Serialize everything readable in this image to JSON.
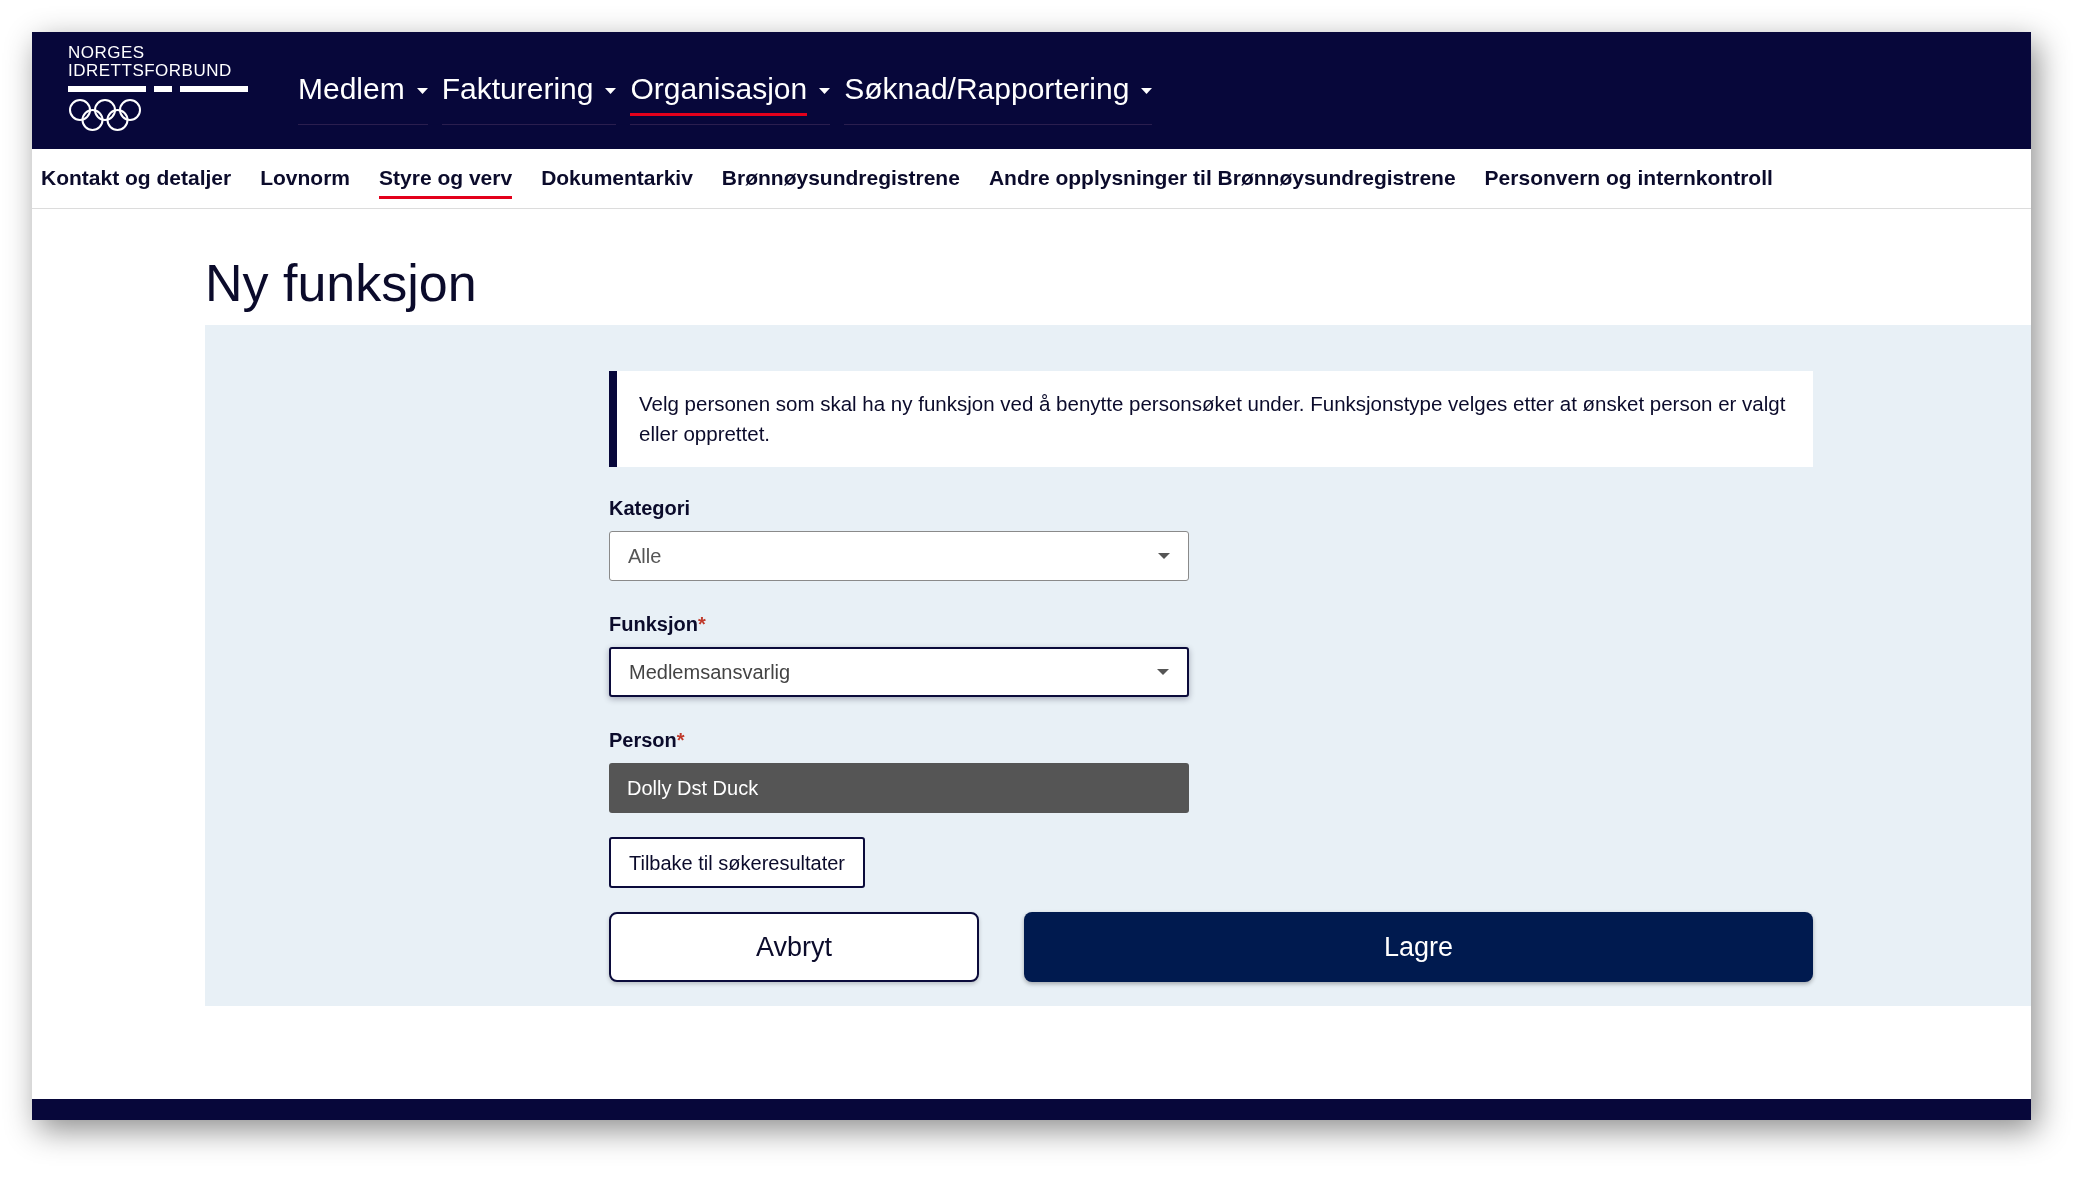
{
  "logo": {
    "lines": [
      "NORGES",
      "IDRETTSFORBUND"
    ]
  },
  "main_nav": [
    {
      "label": "Medlem",
      "selected": false
    },
    {
      "label": "Fakturering",
      "selected": false
    },
    {
      "label": "Organisasjon",
      "selected": true
    },
    {
      "label": "Søknad/Rapportering",
      "selected": false
    }
  ],
  "sub_nav": [
    {
      "label": "Kontakt og detaljer",
      "selected": false
    },
    {
      "label": "Lovnorm",
      "selected": false
    },
    {
      "label": "Styre og verv",
      "selected": true
    },
    {
      "label": "Dokumentarkiv",
      "selected": false
    },
    {
      "label": "Brønnøysundregistrene",
      "selected": false
    },
    {
      "label": "Andre opplysninger til Brønnøysundregistrene",
      "selected": false
    },
    {
      "label": "Personvern og internkontroll",
      "selected": false
    }
  ],
  "title": "Ny funksjon",
  "info": "Velg personen som skal ha ny funksjon ved å benytte personsøket under. Funksjonstype velges etter at ønsket person er valgt eller opprettet.",
  "fields": [
    {
      "kind": "select",
      "label": "Kategori",
      "focused": false,
      "value": "Alle"
    },
    {
      "kind": "select",
      "label": "Funksjon",
      "required_mark": "*",
      "focused": true,
      "value": "Medlemsansvarlig"
    },
    {
      "kind": "readonly",
      "label": "Person",
      "required_mark": "*",
      "value": "Dolly Dst Duck"
    }
  ],
  "back_button": "Tilbake til søkeresultater",
  "actions": [
    {
      "kind": "secondary",
      "label": "Avbryt"
    },
    {
      "kind": "primary",
      "label": "Lagre"
    }
  ]
}
